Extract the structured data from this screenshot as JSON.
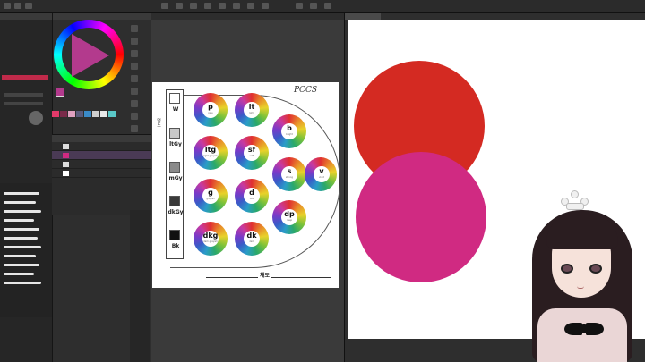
{
  "chart_panel": {
    "title": "PCCS",
    "greys": [
      {
        "label": "W",
        "sub": "",
        "color": "#ffffff"
      },
      {
        "label": "ltGy",
        "sub": "",
        "color": "#c8c8c8"
      },
      {
        "label": "mGy",
        "sub": "",
        "color": "#8a8a8a"
      },
      {
        "label": "dkGy",
        "sub": "",
        "color": "#3a3a3a"
      },
      {
        "label": "Bk",
        "sub": "",
        "color": "#111111"
      }
    ],
    "tones": [
      {
        "label": "p",
        "sub": "pale"
      },
      {
        "label": "lt",
        "sub": "light"
      },
      {
        "label": "b",
        "sub": "bright"
      },
      {
        "label": "ltg",
        "sub": "light grayish"
      },
      {
        "label": "sf",
        "sub": "soft"
      },
      {
        "label": "s",
        "sub": "strong"
      },
      {
        "label": "v",
        "sub": "vivid"
      },
      {
        "label": "g",
        "sub": "grayish"
      },
      {
        "label": "d",
        "sub": "dull"
      },
      {
        "label": "dp",
        "sub": "deep"
      },
      {
        "label": "dkg",
        "sub": "dark grayish"
      },
      {
        "label": "dk",
        "sub": "dark"
      }
    ],
    "axis_vertical": "명도",
    "axis_horizontal": "채도"
  },
  "right_canvas": {
    "circle_top_color": "#d42a22",
    "circle_bottom_color": "#d02a82"
  },
  "colors": {
    "main_color": "#b33a8d",
    "swatches": [
      "#e23a6a",
      "#7a2a4a",
      "#e0a0c0",
      "#5a5a7a",
      "#3a8ac8",
      "#d0d0d0",
      "#e8e8e8",
      "#5ac8c8"
    ]
  },
  "icons": [
    "crown-icon",
    "color-wheel-icon"
  ]
}
